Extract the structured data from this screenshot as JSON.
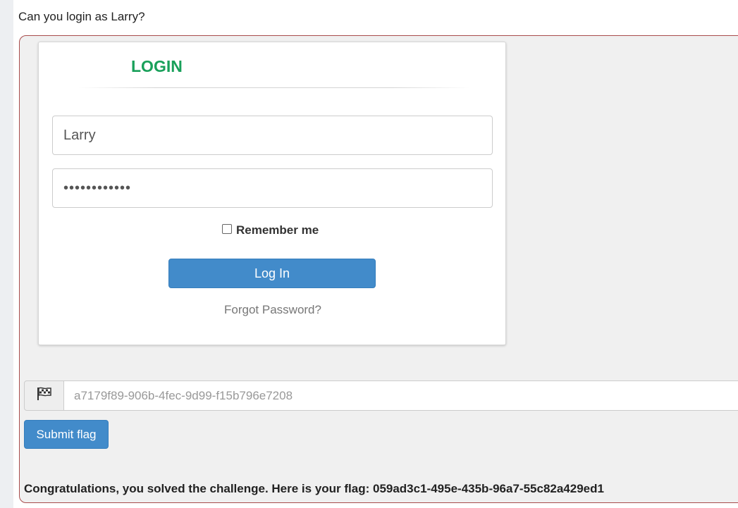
{
  "page": {
    "question": "Can you login as Larry?"
  },
  "login": {
    "title": "LOGIN",
    "username_value": "Larry",
    "password_value": "••••••••••••",
    "remember_label": "Remember me",
    "login_button": "Log In",
    "forgot_link": "Forgot Password?"
  },
  "flag_form": {
    "flag_icon": "flag-icon",
    "flag_value": "a7179f89-906b-4fec-9d99-f15b796e7208",
    "submit_label": "Submit flag"
  },
  "result": {
    "message": "Congratulations, you solved the challenge. Here is your flag: 059ad3c1-495e-435b-96a7-55c82a429ed1"
  },
  "colors": {
    "accent_blue": "#428bca",
    "login_title_green": "#19a05a",
    "frame_border": "#a84c4c"
  }
}
